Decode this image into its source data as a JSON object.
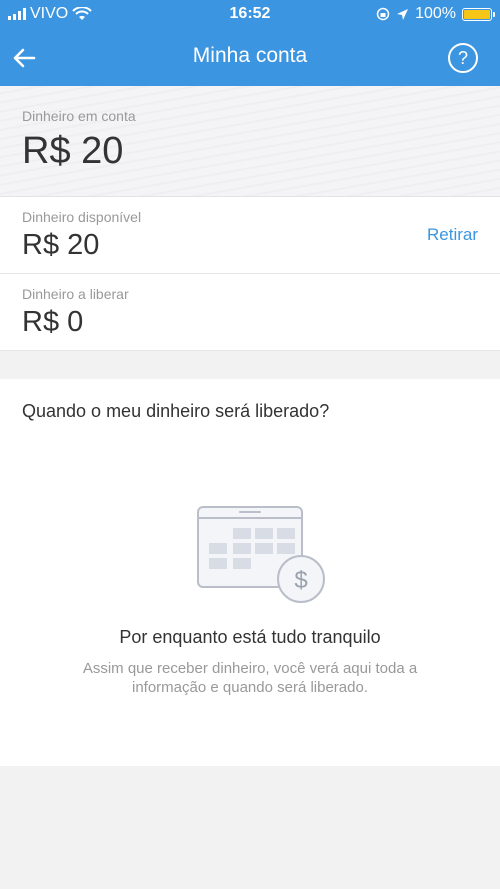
{
  "status": {
    "carrier": "VIVO",
    "time": "16:52",
    "battery": "100%"
  },
  "nav": {
    "title": "Minha conta",
    "help_symbol": "?"
  },
  "balance": {
    "label": "Dinheiro em conta",
    "amount": "R$ 20"
  },
  "available": {
    "label": "Dinheiro disponível",
    "amount": "R$ 20",
    "action": "Retirar"
  },
  "pending": {
    "label": "Dinheiro a liberar",
    "amount": "R$ 0"
  },
  "release": {
    "question": "Quando o meu dinheiro será liberado?",
    "empty_title": "Por enquanto está tudo tranquilo",
    "empty_message": "Assim que receber dinheiro, você verá aqui toda a informação e quando será liberado.",
    "icon": "calendar-money-icon"
  },
  "colors": {
    "brand": "#3b95e0",
    "battery_fill": "#f5c518"
  }
}
